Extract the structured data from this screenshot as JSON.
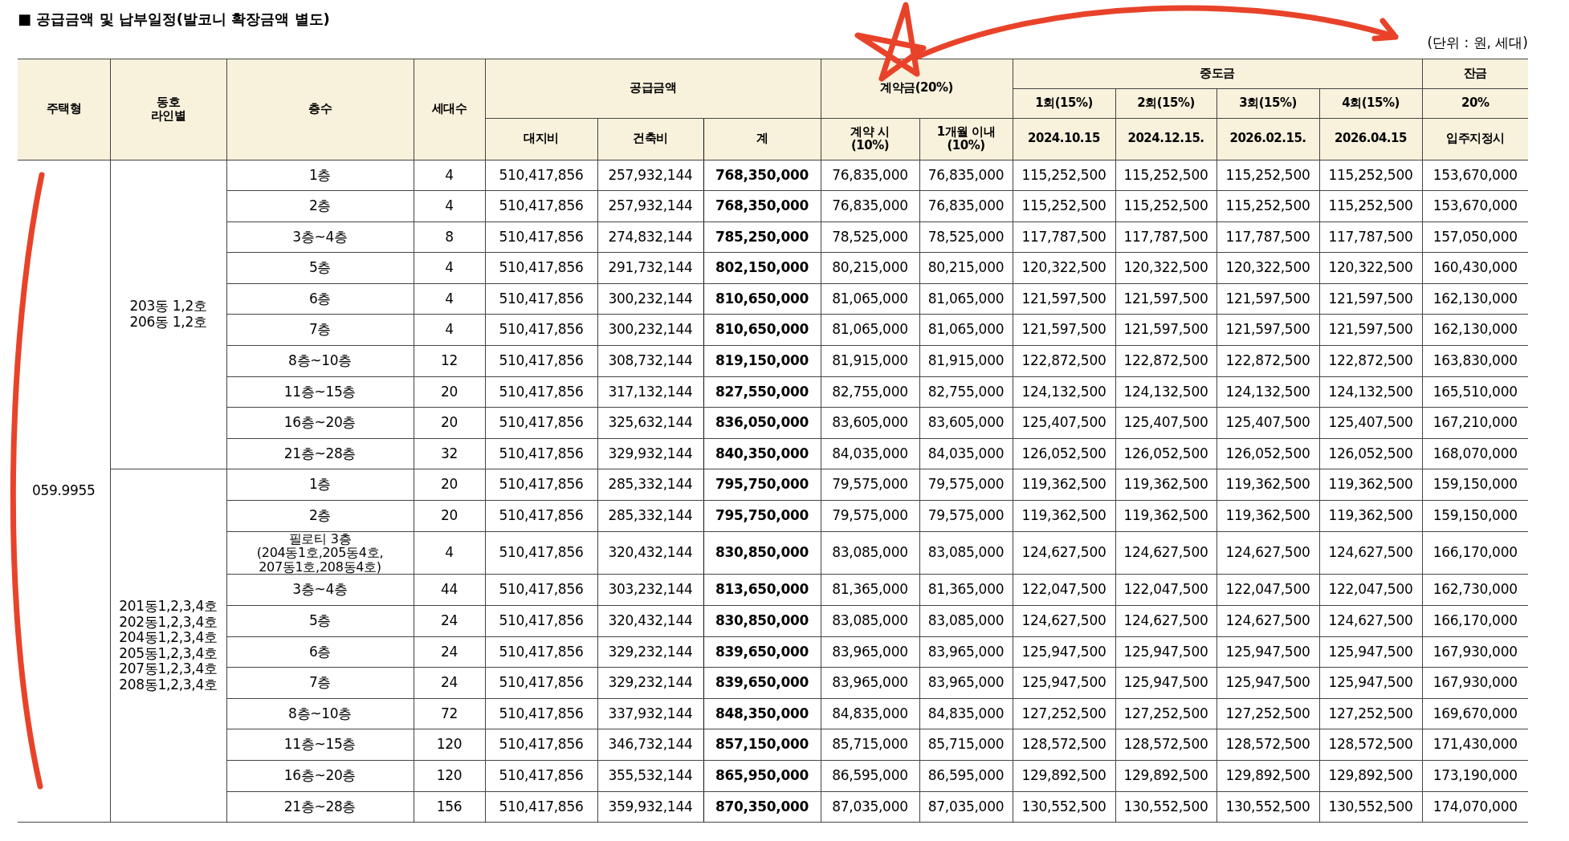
{
  "title": "■ 공급금액 및 납부일정(발코니 확장금액 별도)",
  "unit_note": "(단위 : 원, 세대)",
  "columns": {
    "house_type": "주택형",
    "line": "동호\n라인별",
    "floor": "층수",
    "units": "세대수",
    "supply": {
      "label": "공급금액",
      "subs": [
        "대지비",
        "건축비",
        "계"
      ]
    },
    "deposit": {
      "label": "계약금(20%)",
      "subs": [
        "계약 시\n(10%)",
        "1개월 이내\n(10%)"
      ]
    },
    "interim": {
      "label": "중도금",
      "installments": [
        {
          "label": "1회(15%)",
          "date": "2024.10.15"
        },
        {
          "label": "2회(15%)",
          "date": "2024.12.15."
        },
        {
          "label": "3회(15%)",
          "date": "2026.02.15."
        },
        {
          "label": "4회(15%)",
          "date": "2026.04.15"
        }
      ]
    },
    "balance": {
      "label": "잔금",
      "rate": "20%",
      "when": "입주지정시"
    }
  },
  "groups": [
    {
      "house_type": "059.9955",
      "lines": [
        {
          "label": "203동  1,2호\n206동  1,2호",
          "rows": [
            {
              "floor": "1층",
              "units": "4",
              "values": [
                "510,417,856",
                "257,932,144",
                "768,350,000",
                "76,835,000",
                "76,835,000",
                "115,252,500",
                "115,252,500",
                "115,252,500",
                "115,252,500",
                "153,670,000"
              ]
            },
            {
              "floor": "2층",
              "units": "4",
              "values": [
                "510,417,856",
                "257,932,144",
                "768,350,000",
                "76,835,000",
                "76,835,000",
                "115,252,500",
                "115,252,500",
                "115,252,500",
                "115,252,500",
                "153,670,000"
              ]
            },
            {
              "floor": "3층~4층",
              "units": "8",
              "values": [
                "510,417,856",
                "274,832,144",
                "785,250,000",
                "78,525,000",
                "78,525,000",
                "117,787,500",
                "117,787,500",
                "117,787,500",
                "117,787,500",
                "157,050,000"
              ]
            },
            {
              "floor": "5층",
              "units": "4",
              "values": [
                "510,417,856",
                "291,732,144",
                "802,150,000",
                "80,215,000",
                "80,215,000",
                "120,322,500",
                "120,322,500",
                "120,322,500",
                "120,322,500",
                "160,430,000"
              ]
            },
            {
              "floor": "6층",
              "units": "4",
              "values": [
                "510,417,856",
                "300,232,144",
                "810,650,000",
                "81,065,000",
                "81,065,000",
                "121,597,500",
                "121,597,500",
                "121,597,500",
                "121,597,500",
                "162,130,000"
              ]
            },
            {
              "floor": "7층",
              "units": "4",
              "values": [
                "510,417,856",
                "300,232,144",
                "810,650,000",
                "81,065,000",
                "81,065,000",
                "121,597,500",
                "121,597,500",
                "121,597,500",
                "121,597,500",
                "162,130,000"
              ]
            },
            {
              "floor": "8층~10층",
              "units": "12",
              "values": [
                "510,417,856",
                "308,732,144",
                "819,150,000",
                "81,915,000",
                "81,915,000",
                "122,872,500",
                "122,872,500",
                "122,872,500",
                "122,872,500",
                "163,830,000"
              ]
            },
            {
              "floor": "11층~15층",
              "units": "20",
              "values": [
                "510,417,856",
                "317,132,144",
                "827,550,000",
                "82,755,000",
                "82,755,000",
                "124,132,500",
                "124,132,500",
                "124,132,500",
                "124,132,500",
                "165,510,000"
              ]
            },
            {
              "floor": "16층~20층",
              "units": "20",
              "values": [
                "510,417,856",
                "325,632,144",
                "836,050,000",
                "83,605,000",
                "83,605,000",
                "125,407,500",
                "125,407,500",
                "125,407,500",
                "125,407,500",
                "167,210,000"
              ]
            },
            {
              "floor": "21층~28층",
              "units": "32",
              "values": [
                "510,417,856",
                "329,932,144",
                "840,350,000",
                "84,035,000",
                "84,035,000",
                "126,052,500",
                "126,052,500",
                "126,052,500",
                "126,052,500",
                "168,070,000"
              ]
            }
          ]
        },
        {
          "label": "201동1,2,3,4호\n202동1,2,3,4호\n204동1,2,3,4호\n205동1,2,3,4호\n207동1,2,3,4호\n208동1,2,3,4호",
          "rows": [
            {
              "floor": "1층",
              "units": "20",
              "values": [
                "510,417,856",
                "285,332,144",
                "795,750,000",
                "79,575,000",
                "79,575,000",
                "119,362,500",
                "119,362,500",
                "119,362,500",
                "119,362,500",
                "159,150,000"
              ]
            },
            {
              "floor": "2층",
              "units": "20",
              "values": [
                "510,417,856",
                "285,332,144",
                "795,750,000",
                "79,575,000",
                "79,575,000",
                "119,362,500",
                "119,362,500",
                "119,362,500",
                "119,362,500",
                "159,150,000"
              ]
            },
            {
              "floor": "필로티  3층\n(204동1호,205동4호,\n207동1호,208동4호)",
              "units": "4",
              "values": [
                "510,417,856",
                "320,432,144",
                "830,850,000",
                "83,085,000",
                "83,085,000",
                "124,627,500",
                "124,627,500",
                "124,627,500",
                "124,627,500",
                "166,170,000"
              ]
            },
            {
              "floor": "3층~4층",
              "units": "44",
              "values": [
                "510,417,856",
                "303,232,144",
                "813,650,000",
                "81,365,000",
                "81,365,000",
                "122,047,500",
                "122,047,500",
                "122,047,500",
                "122,047,500",
                "162,730,000"
              ]
            },
            {
              "floor": "5층",
              "units": "24",
              "values": [
                "510,417,856",
                "320,432,144",
                "830,850,000",
                "83,085,000",
                "83,085,000",
                "124,627,500",
                "124,627,500",
                "124,627,500",
                "124,627,500",
                "166,170,000"
              ]
            },
            {
              "floor": "6층",
              "units": "24",
              "values": [
                "510,417,856",
                "329,232,144",
                "839,650,000",
                "83,965,000",
                "83,965,000",
                "125,947,500",
                "125,947,500",
                "125,947,500",
                "125,947,500",
                "167,930,000"
              ]
            },
            {
              "floor": "7층",
              "units": "24",
              "values": [
                "510,417,856",
                "329,232,144",
                "839,650,000",
                "83,965,000",
                "83,965,000",
                "125,947,500",
                "125,947,500",
                "125,947,500",
                "125,947,500",
                "167,930,000"
              ]
            },
            {
              "floor": "8층~10층",
              "units": "72",
              "values": [
                "510,417,856",
                "337,932,144",
                "848,350,000",
                "84,835,000",
                "84,835,000",
                "127,252,500",
                "127,252,500",
                "127,252,500",
                "127,252,500",
                "169,670,000"
              ]
            },
            {
              "floor": "11층~15층",
              "units": "120",
              "values": [
                "510,417,856",
                "346,732,144",
                "857,150,000",
                "85,715,000",
                "85,715,000",
                "128,572,500",
                "128,572,500",
                "128,572,500",
                "128,572,500",
                "171,430,000"
              ]
            },
            {
              "floor": "16층~20층",
              "units": "120",
              "values": [
                "510,417,856",
                "355,532,144",
                "865,950,000",
                "86,595,000",
                "86,595,000",
                "129,892,500",
                "129,892,500",
                "129,892,500",
                "129,892,500",
                "173,190,000"
              ]
            },
            {
              "floor": "21층~28층",
              "units": "156",
              "values": [
                "510,417,856",
                "359,932,144",
                "870,350,000",
                "87,035,000",
                "87,035,000",
                "130,552,500",
                "130,552,500",
                "130,552,500",
                "130,552,500",
                "174,070,000"
              ]
            }
          ]
        }
      ]
    }
  ]
}
